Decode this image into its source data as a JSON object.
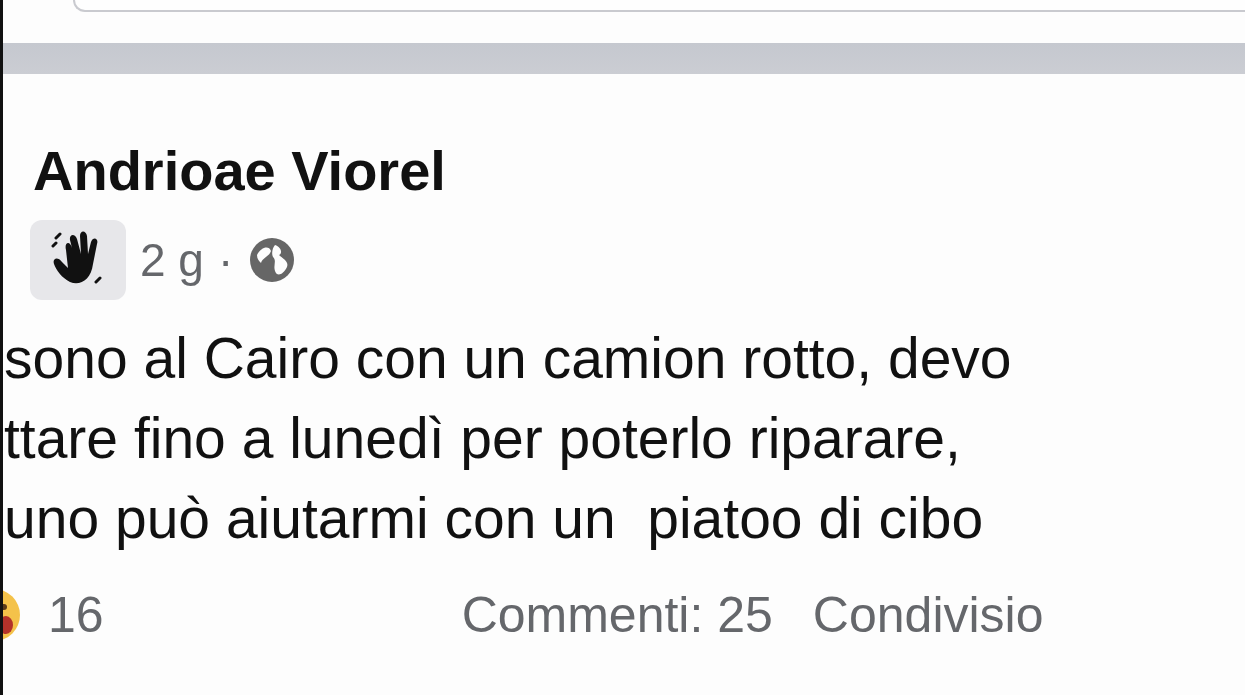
{
  "post": {
    "author": "Andrioae Viorel",
    "time": "2 g",
    "separator": "·",
    "lines": [
      "sono al Cairo con un camion rotto, devo",
      "ttare fino a lunedì per poterlo riparare,",
      "uno può aiutarmi con un  piatoo di cibo"
    ],
    "reactions": "16",
    "comments": "Commenti: 25",
    "shares": "Condivisio"
  }
}
